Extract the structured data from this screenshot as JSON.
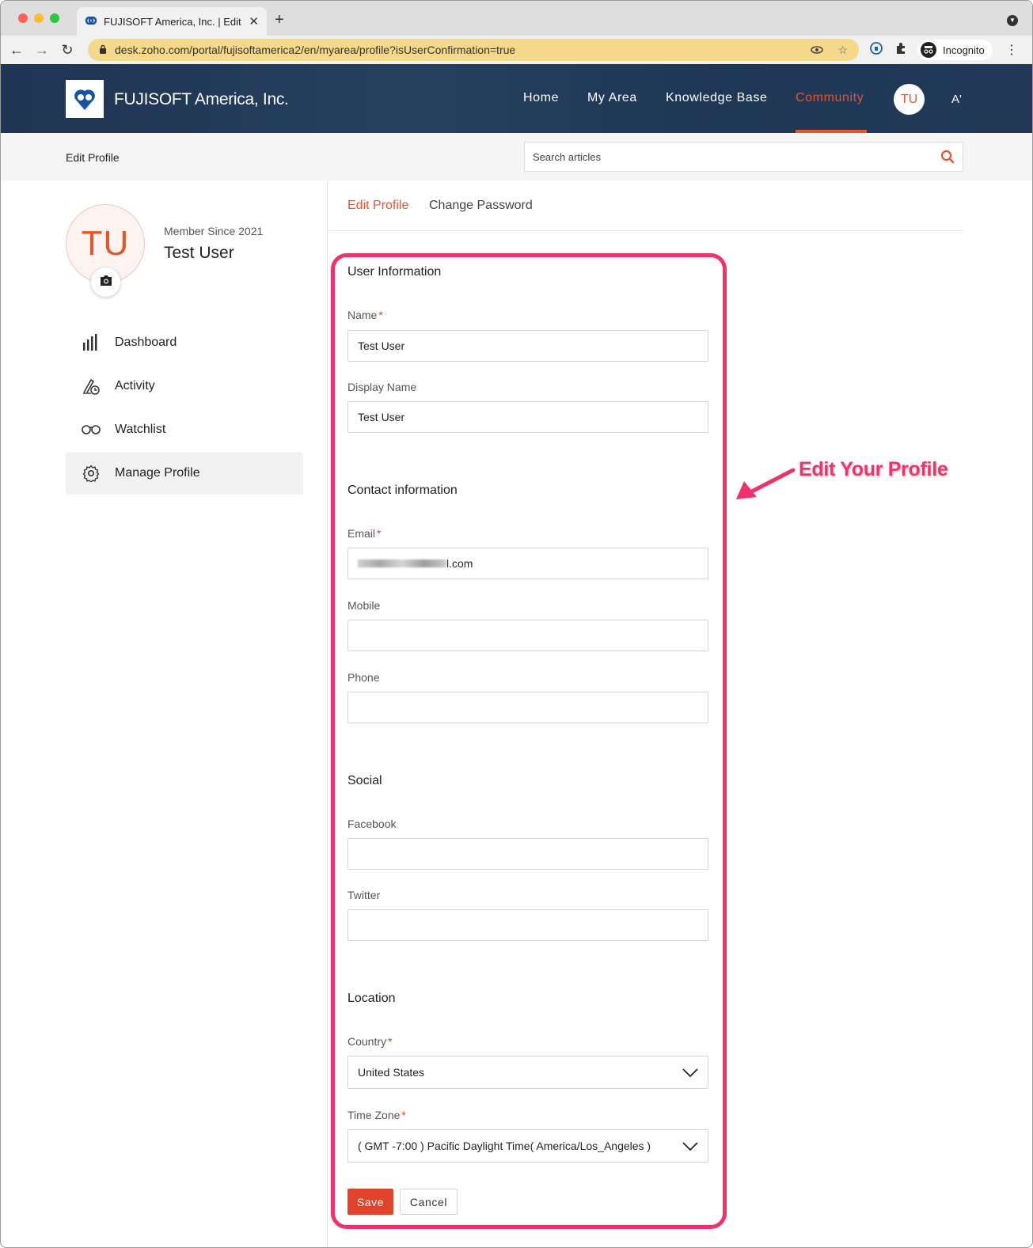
{
  "browser": {
    "tab_title": "FUJISOFT America, Inc. | Edit P",
    "new_tab_label": "+",
    "url": "desk.zoho.com/portal/fujisoftamerica2/en/myarea/profile?isUserConfirmation=true",
    "incognito_label": "Incognito",
    "icons": [
      "back-arrow-icon",
      "forward-arrow-icon",
      "reload-icon",
      "lock-icon",
      "eye-icon",
      "star-icon",
      "password-icon",
      "extensions-icon",
      "incognito-icon",
      "more-icon"
    ]
  },
  "header": {
    "brand": "FUJISOFT America, Inc.",
    "nav": [
      {
        "label": "Home"
      },
      {
        "label": "My Area"
      },
      {
        "label": "Knowledge Base"
      },
      {
        "label": "Community"
      }
    ],
    "active_nav": "Community",
    "avatar_initials": "TU",
    "font_toggle": "A'"
  },
  "subbar": {
    "title": "Edit Profile",
    "search_placeholder": "Search articles"
  },
  "profile": {
    "initials": "TU",
    "member_since": "Member Since 2021",
    "name": "Test User"
  },
  "sidebar": {
    "items": [
      {
        "label": "Dashboard",
        "icon": "bar-chart-icon"
      },
      {
        "label": "Activity",
        "icon": "activity-icon"
      },
      {
        "label": "Watchlist",
        "icon": "binoculars-icon"
      },
      {
        "label": "Manage Profile",
        "icon": "gear-icon"
      }
    ],
    "selected": "Manage Profile"
  },
  "tabs": {
    "edit_profile": "Edit Profile",
    "change_password": "Change Password"
  },
  "form": {
    "user_info": {
      "title": "User Information",
      "name_label": "Name",
      "name_value": "Test User",
      "display_name_label": "Display Name",
      "display_name_value": "Test User"
    },
    "contact": {
      "title": "Contact information",
      "email_label": "Email",
      "email_suffix": "l.com",
      "mobile_label": "Mobile",
      "mobile_value": "",
      "phone_label": "Phone",
      "phone_value": ""
    },
    "social": {
      "title": "Social",
      "facebook_label": "Facebook",
      "facebook_value": "",
      "twitter_label": "Twitter",
      "twitter_value": ""
    },
    "location": {
      "title": "Location",
      "country_label": "Country",
      "country_value": "United States",
      "timezone_label": "Time Zone",
      "timezone_value": "( GMT -7:00 ) Pacific Daylight Time( America/Los_Angeles )"
    },
    "required_mark": "*",
    "save_label": "Save",
    "cancel_label": "Cancel"
  },
  "annotation": {
    "callout_text": "Edit Your Profile",
    "color": "#f2316a"
  },
  "colors": {
    "accent": "#e8542a",
    "header_bg": "#1e3553"
  }
}
